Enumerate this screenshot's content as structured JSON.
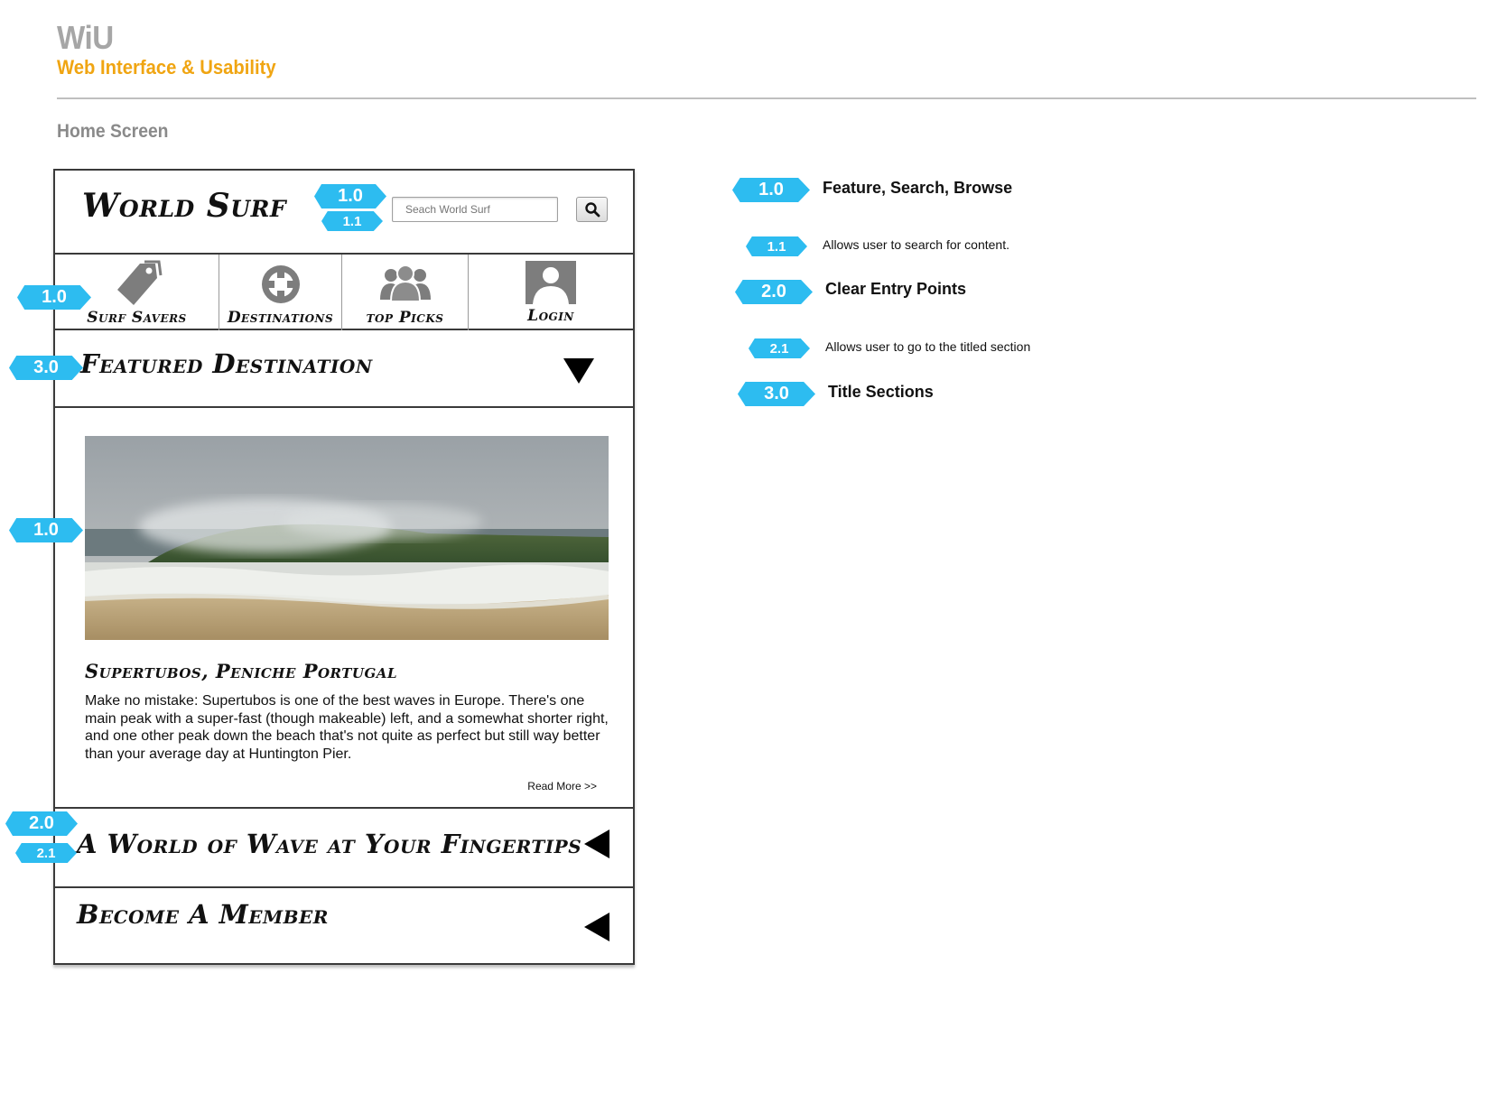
{
  "header": {
    "brand": "WiU",
    "subtitle": "Web Interface & Usability",
    "screen_label": "Home Screen"
  },
  "app": {
    "logo": "World Surf",
    "search_placeholder": "Seach World Surf",
    "search_icon": "search-icon"
  },
  "nav": [
    {
      "label": "Surf Savers",
      "icon": "tag-icon"
    },
    {
      "label": "Destinations",
      "icon": "crosshair-icon"
    },
    {
      "label": "top Picks",
      "icon": "group-icon"
    },
    {
      "label": "Login",
      "icon": "user-icon"
    }
  ],
  "sections": {
    "featured_title": "Featured Destination",
    "featured_heading": "Supertubos, Peniche Portugal",
    "featured_body": "Make no mistake: Supertubos is one of the best waves in Europe. There's one main peak with a super-fast (though makeable) left, and a somewhat shorter right, and one other peak down the beach that's not quite as perfect but still way better than your average day at Huntington Pier.",
    "read_more": "Read More >>",
    "world_title": "A World of Wave at Your Fingertips",
    "member_title": "Become A Member"
  },
  "annotations": {
    "search_main": "1.0",
    "search_sub": "1.1",
    "nav": "1.0",
    "featured": "3.0",
    "photo": "1.0",
    "world_main": "2.0",
    "world_sub": "2.1"
  },
  "legend": [
    {
      "badge": "1.0",
      "text": "Feature, Search, Browse",
      "kind": "heading"
    },
    {
      "badge": "1.1",
      "text": "Allows user to search for content.",
      "kind": "description"
    },
    {
      "badge": "2.0",
      "text": "Clear Entry Points",
      "kind": "heading"
    },
    {
      "badge": "2.1",
      "text": "Allows user to go to the titled section",
      "kind": "description"
    },
    {
      "badge": "3.0",
      "text": "Title Sections",
      "kind": "heading"
    }
  ],
  "colors": {
    "badge": "#2dbcf0",
    "brand": "#a6a6a6",
    "subtitle": "#f0a512",
    "icon_gray": "#7d7d7d"
  }
}
